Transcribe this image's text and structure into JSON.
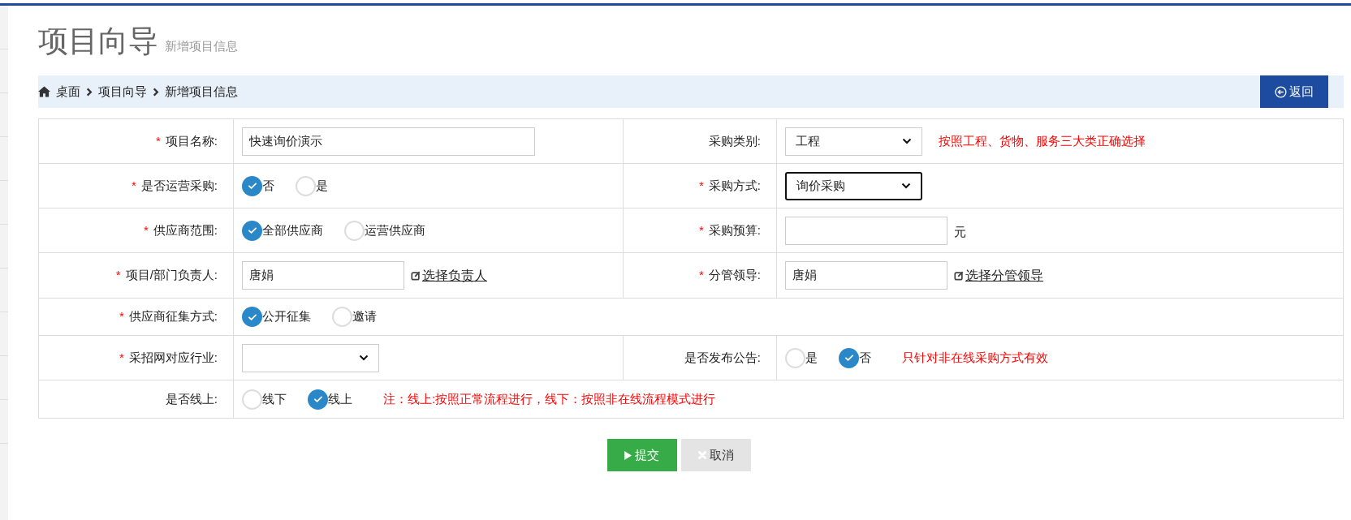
{
  "header": {
    "title": "项目向导",
    "subtitle": "新增项目信息"
  },
  "breadcrumb": [
    {
      "label": "桌面",
      "kind": "home"
    },
    {
      "label": "项目向导",
      "kind": "link"
    },
    {
      "label": "新增项目信息",
      "kind": "link"
    }
  ],
  "back_button": {
    "label": "返回"
  },
  "rows": [
    {
      "left": {
        "mark": "*",
        "label": "项目名称:",
        "field": {
          "kind": "text",
          "value": "快速询价演示"
        }
      },
      "right": {
        "label": "采购类别:",
        "field": {
          "kind": "select",
          "value": "工程",
          "focused": false,
          "note": "按照工程、货物、服务三大类正确选择"
        }
      }
    },
    {
      "left": {
        "mark": "*",
        "label": "是否运营采购:",
        "field": {
          "kind": "radio",
          "options": [
            {
              "label": "否",
              "selected": true
            },
            {
              "label": "是",
              "selected": false
            }
          ]
        }
      },
      "right": {
        "mark": "*",
        "label": "采购方式:",
        "field": {
          "kind": "select",
          "value": "询价采购",
          "focused": true
        }
      }
    },
    {
      "left": {
        "mark": "*",
        "label": "供应商范围:",
        "field": {
          "kind": "radio",
          "options": [
            {
              "label": "全部供应商",
              "selected": true
            },
            {
              "label": "运营供应商",
              "selected": false
            }
          ]
        }
      },
      "right": {
        "mark": "*",
        "label": "采购预算:",
        "field": {
          "kind": "unit",
          "unit": "元"
        }
      }
    },
    {
      "left": {
        "mark": "*",
        "label": "项目/部门负责人:",
        "field": {
          "kind": "picker",
          "value": "唐娟",
          "link": "选择负责人"
        }
      },
      "right": {
        "mark": "*",
        "label": "分管领导:",
        "field": {
          "kind": "picker",
          "value": "唐娟",
          "link": "选择分管领导"
        }
      }
    },
    {
      "left": {
        "mark": "*",
        "label": "供应商征集方式:",
        "field": {
          "kind": "radio",
          "options": [
            {
              "label": "公开征集",
              "selected": true
            },
            {
              "label": "邀请",
              "selected": false
            }
          ]
        }
      }
    },
    {
      "left": {
        "mark": "*",
        "label": "采招网对应行业:",
        "field": {
          "kind": "select",
          "focused": false
        }
      },
      "right": {
        "label": "是否发布公告:",
        "field": {
          "kind": "radio",
          "options": [
            {
              "label": "是",
              "selected": false
            },
            {
              "label": "否",
              "selected": true
            }
          ],
          "note": "只针对非在线采购方式有效"
        }
      }
    },
    {
      "left": {
        "label": "是否线上:",
        "field": {
          "kind": "radio",
          "options": [
            {
              "label": "线下",
              "selected": false
            },
            {
              "label": "线上",
              "selected": true
            }
          ],
          "note": "注：线上:按照正常流程进行，线下：按照非在线流程模式进行"
        }
      }
    }
  ],
  "actions": [
    {
      "label": "提交",
      "kind": "submit"
    },
    {
      "label": "取消",
      "kind": "cancel"
    }
  ]
}
